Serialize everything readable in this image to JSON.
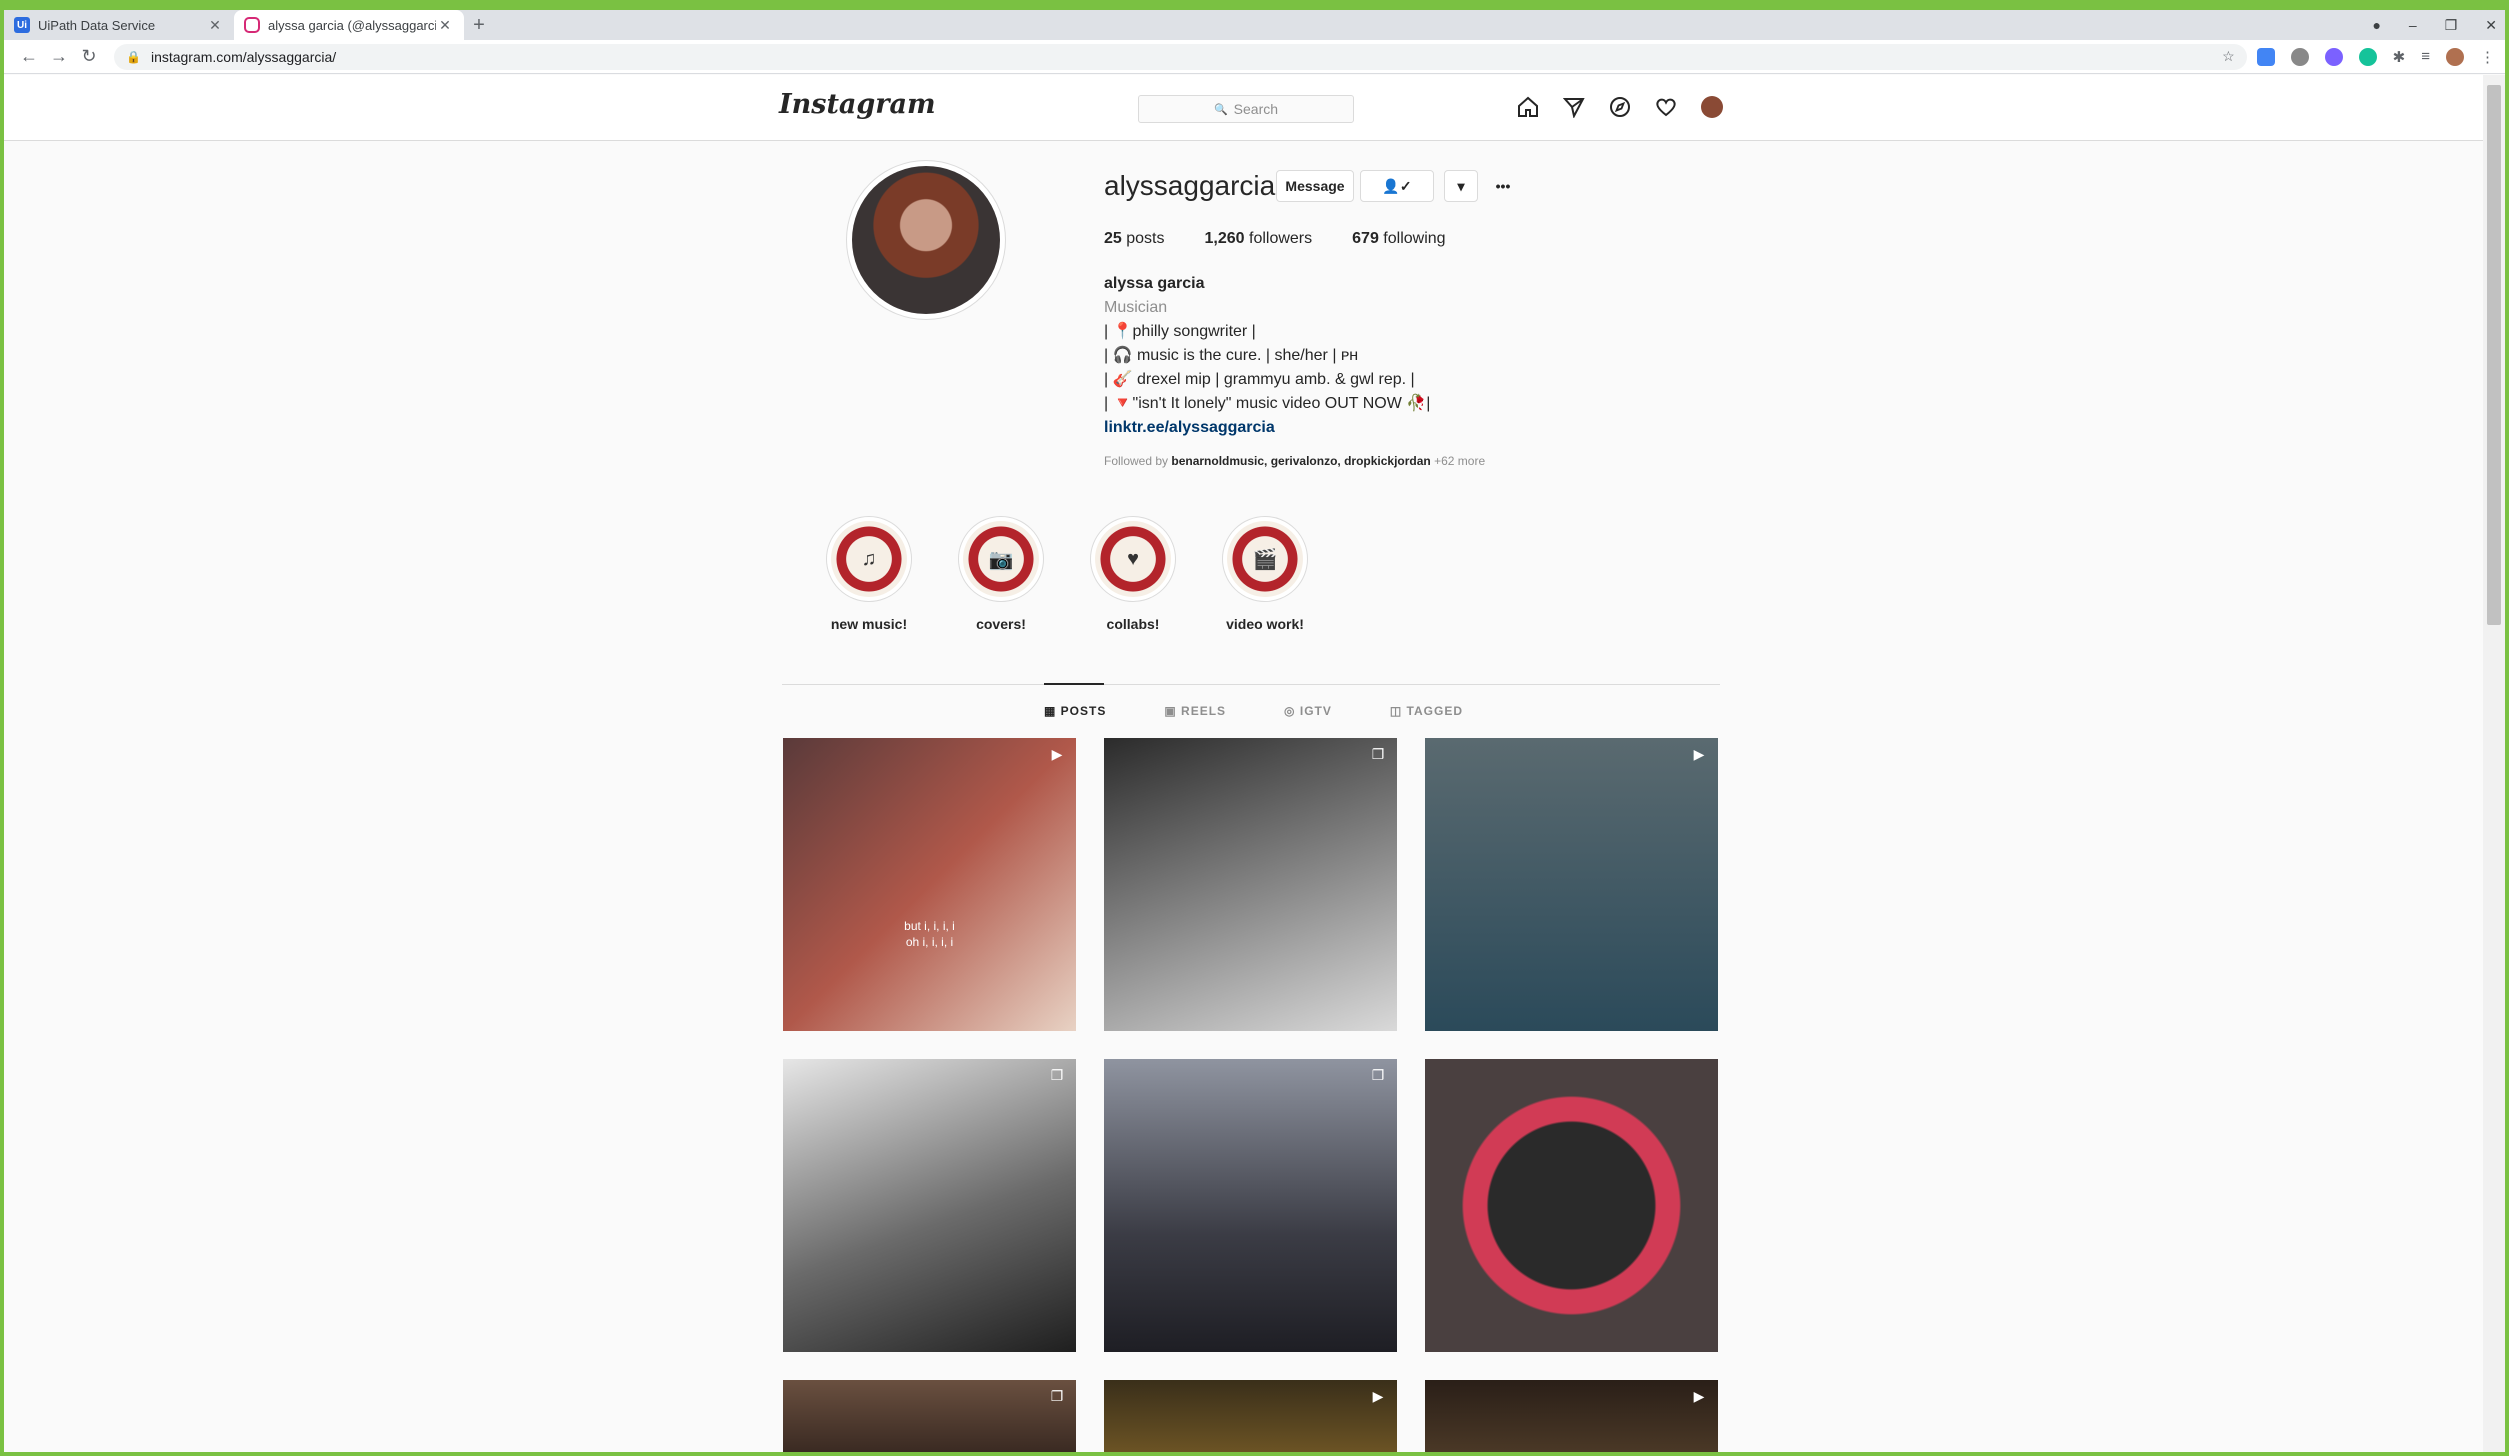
{
  "browser": {
    "tabs": [
      {
        "title": "UiPath Data Service",
        "favicon": "uipath-favicon"
      },
      {
        "title": "alyssa garcia (@alyssaggarcia) • I",
        "favicon": "instagram-favicon"
      }
    ],
    "new_tab": "+",
    "url": "instagram.com/alyssaggarcia/",
    "window_controls": {
      "minimize": "–",
      "restore": "❐",
      "close": "✕"
    }
  },
  "ig": {
    "logo": "Instagram",
    "search_placeholder": "Search",
    "profile": {
      "username": "alyssaggarcia",
      "message_btn": "Message",
      "follow_icon": "👤✓",
      "dropdown": "▾",
      "more": "•••",
      "posts_count": "25",
      "posts_label": "posts",
      "followers_count": "1,260",
      "followers_label": "followers",
      "following_count": "679",
      "following_label": "following",
      "name": "alyssa garcia",
      "category": "Musician",
      "bio": [
        "| 📍philly songwriter |",
        "| 🎧 music is the cure. | she/her | ᴘʜ",
        "| 🎸 drexel mip | grammyu amb. & gwl rep. |",
        "| 🔻\"isn't It lonely\" music video OUT NOW 🥀|"
      ],
      "link": "linktr.ee/alyssaggarcia",
      "followed_by_prefix": "Followed by",
      "followed_by_names": "benarnoldmusic, gerivalonzo, dropkickjordan",
      "followed_by_more": "+62 more"
    },
    "highlights": [
      {
        "label": "new music!",
        "icon": "♫"
      },
      {
        "label": "covers!",
        "icon": "📷"
      },
      {
        "label": "collabs!",
        "icon": "♥"
      },
      {
        "label": "video work!",
        "icon": "🎬"
      }
    ],
    "tabs": [
      "POSTS",
      "REELS",
      "IGTV",
      "TAGGED"
    ],
    "post_caption": [
      "but i, i, i, i",
      "oh i, i, i, i"
    ],
    "colors": {
      "accent_border": "#7ac142",
      "link": "#00376b"
    }
  }
}
